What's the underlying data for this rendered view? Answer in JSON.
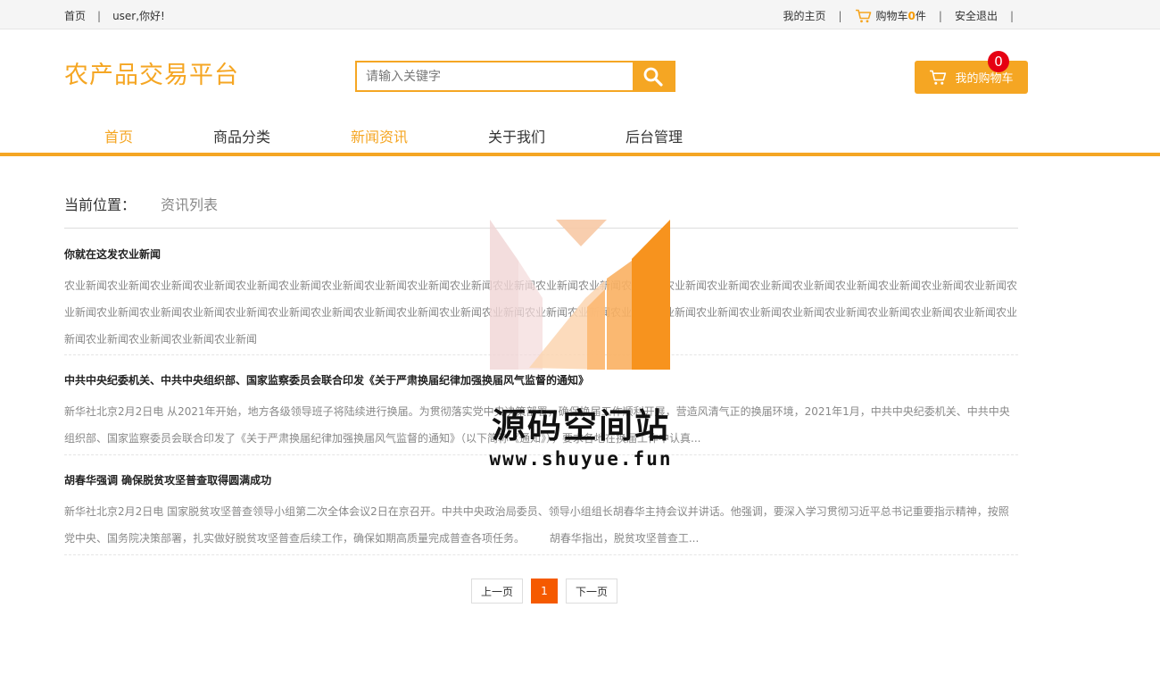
{
  "topbar": {
    "home": "首页",
    "greeting": "user,你好!",
    "my_home": "我的主页",
    "cart_prefix": "购物车",
    "cart_count": "0",
    "cart_suffix": "件",
    "logout": "安全退出"
  },
  "header": {
    "logo": "农产品交易平台",
    "search_placeholder": "请输入关键字",
    "my_cart": "我的购物车",
    "cart_badge": "0"
  },
  "nav": {
    "items": [
      {
        "label": "首页"
      },
      {
        "label": "商品分类"
      },
      {
        "label": "新闻资讯"
      },
      {
        "label": "关于我们"
      },
      {
        "label": "后台管理"
      }
    ]
  },
  "breadcrumb": {
    "label": "当前位置：",
    "current": "资讯列表"
  },
  "news": [
    {
      "title": "你就在这发农业新闻",
      "body": "农业新闻农业新闻农业新闻农业新闻农业新闻农业新闻农业新闻农业新闻农业新闻农业新闻农业新闻农业新闻农业新闻农业新闻农业新闻农业新闻农业新闻农业新闻农业新闻农业新闻农业新闻农业新闻农业新闻农业新闻农业新闻农业新闻农业新闻农业新闻农业新闻农业新闻农业新闻农业新闻农业新闻农业新闻农业新闻农业新闻农业新闻农业新闻农业新闻农业新闻农业新闻农业新闻农业新闻农业新闻农业新闻农业新闻农业新闻农业新闻农业新闻"
    },
    {
      "title": "中共中央纪委机关、中共中央组织部、国家监察委员会联合印发《关于严肃换届纪律加强换届风气监督的通知》",
      "body": "新华社北京2月2日电 从2021年开始，地方各级领导班子将陆续进行换届。为贯彻落实党中央决策部署，确保换届工作顺利开展，营造风清气正的换届环境，2021年1月，中共中央纪委机关、中共中央组织部、国家监察委员会联合印发了《关于严肃换届纪律加强换届风气监督的通知》（以下简称《通知》），要求各地在换届工作中认真..."
    },
    {
      "title": "胡春华强调 确保脱贫攻坚普查取得圆满成功",
      "body": "新华社北京2月2日电 国家脱贫攻坚普查领导小组第二次全体会议2日在京召开。中共中央政治局委员、领导小组组长胡春华主持会议并讲话。他强调，要深入学习贯彻习近平总书记重要指示精神，按照党中央、国务院决策部署，扎实做好脱贫攻坚普查后续工作，确保如期高质量完成普查各项任务。 　　胡春华指出，脱贫攻坚普查工..."
    }
  ],
  "pager": {
    "prev": "上一页",
    "current": "1",
    "next": "下一页"
  },
  "watermark": {
    "text": "源码空间站",
    "url": "www.shuyue.fun"
  },
  "colors": {
    "accent": "#f5a623",
    "pager_active": "#f55a00",
    "badge": "#e60012"
  }
}
